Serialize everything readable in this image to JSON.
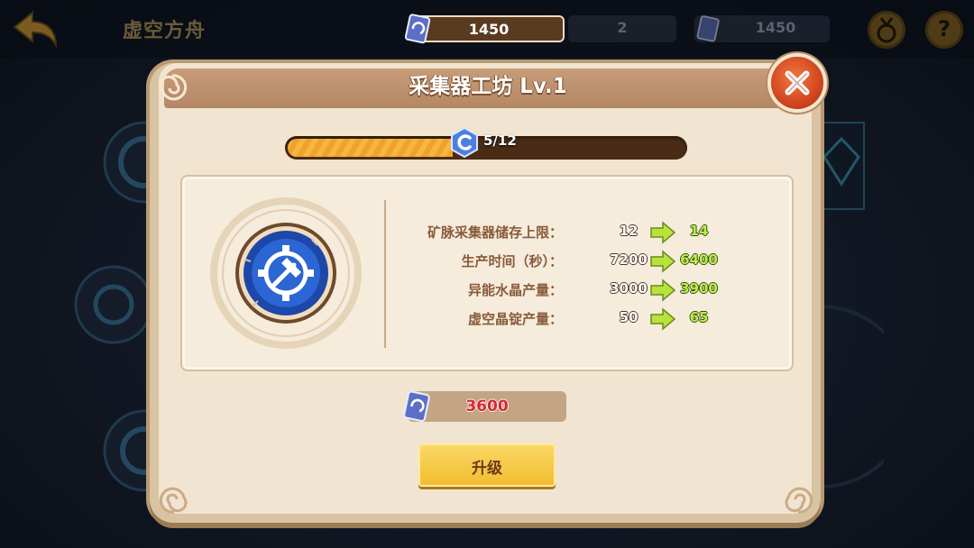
{
  "top_bar": {
    "title": "虚空方舟",
    "resources": [
      {
        "icon": "crystal-book-icon",
        "value": "1450"
      },
      {
        "icon": "",
        "value": "2"
      },
      {
        "icon": "crystal-book-icon",
        "value": "1450"
      }
    ],
    "medal_icon": "medal-icon",
    "help_icon": "?"
  },
  "dialog": {
    "title": "采集器工坊 Lv.1",
    "progress": {
      "current": 5,
      "max": 12,
      "label": "5/12",
      "fraction": 0.4167
    },
    "stats": [
      {
        "label": "矿脉采集器储存上限：",
        "current": "12",
        "next": "14"
      },
      {
        "label": "生产时间（秒）：",
        "current": "7200",
        "next": "6400"
      },
      {
        "label": "异能水晶产量：",
        "current": "3000",
        "next": "3900"
      },
      {
        "label": "虚空晶锭产量：",
        "current": "50",
        "next": "65"
      }
    ],
    "cost": "3600",
    "upgrade_label": "升级"
  },
  "colors": {
    "dialog_bg": "#f1e4d0",
    "header": "#b48765",
    "progress_fill": "#f6b640",
    "cost_text": "#d2273c",
    "next_value": "#b8ef4a",
    "button": "#f1bc2c"
  }
}
